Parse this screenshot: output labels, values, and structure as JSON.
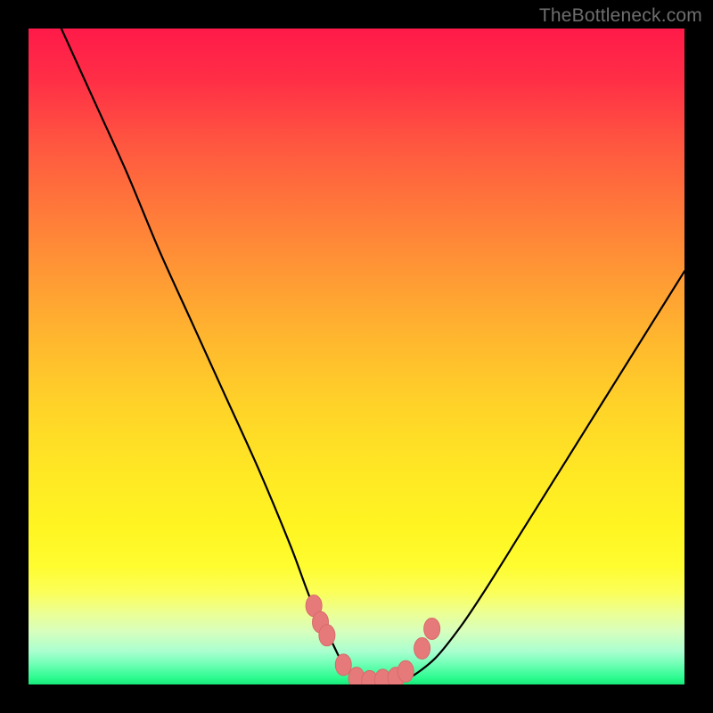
{
  "watermark": "TheBottleneck.com",
  "colors": {
    "page_bg": "#000000",
    "curve_stroke": "#000000",
    "marker_fill": "#e67a7a",
    "marker_stroke": "#d76a6a",
    "gradient_top": "#ff1a49",
    "gradient_bottom": "#18e878"
  },
  "chart_data": {
    "type": "line",
    "title": "",
    "xlabel": "",
    "ylabel": "",
    "xlim": [
      0,
      100
    ],
    "ylim": [
      0,
      100
    ],
    "grid": false,
    "legend": false,
    "series": [
      {
        "name": "bottleneck-curve",
        "x": [
          5,
          10,
          15,
          20,
          25,
          30,
          35,
          40,
          43,
          46,
          48,
          50,
          52,
          55,
          58,
          62,
          66,
          70,
          75,
          80,
          85,
          90,
          95,
          100
        ],
        "y": [
          100,
          89,
          78,
          66,
          55,
          44,
          33,
          21,
          13,
          7,
          3,
          1,
          0.5,
          0.5,
          1,
          4,
          9,
          15,
          23,
          31,
          39,
          47,
          55,
          63
        ]
      }
    ],
    "markers": {
      "name": "highlighted-points",
      "x": [
        43.5,
        44.5,
        45.5,
        48,
        50,
        52,
        54,
        56,
        57.5,
        60,
        61.5
      ],
      "y": [
        12,
        9.5,
        7.5,
        3,
        1,
        0.5,
        0.7,
        1,
        2,
        5.5,
        8.5
      ]
    }
  }
}
